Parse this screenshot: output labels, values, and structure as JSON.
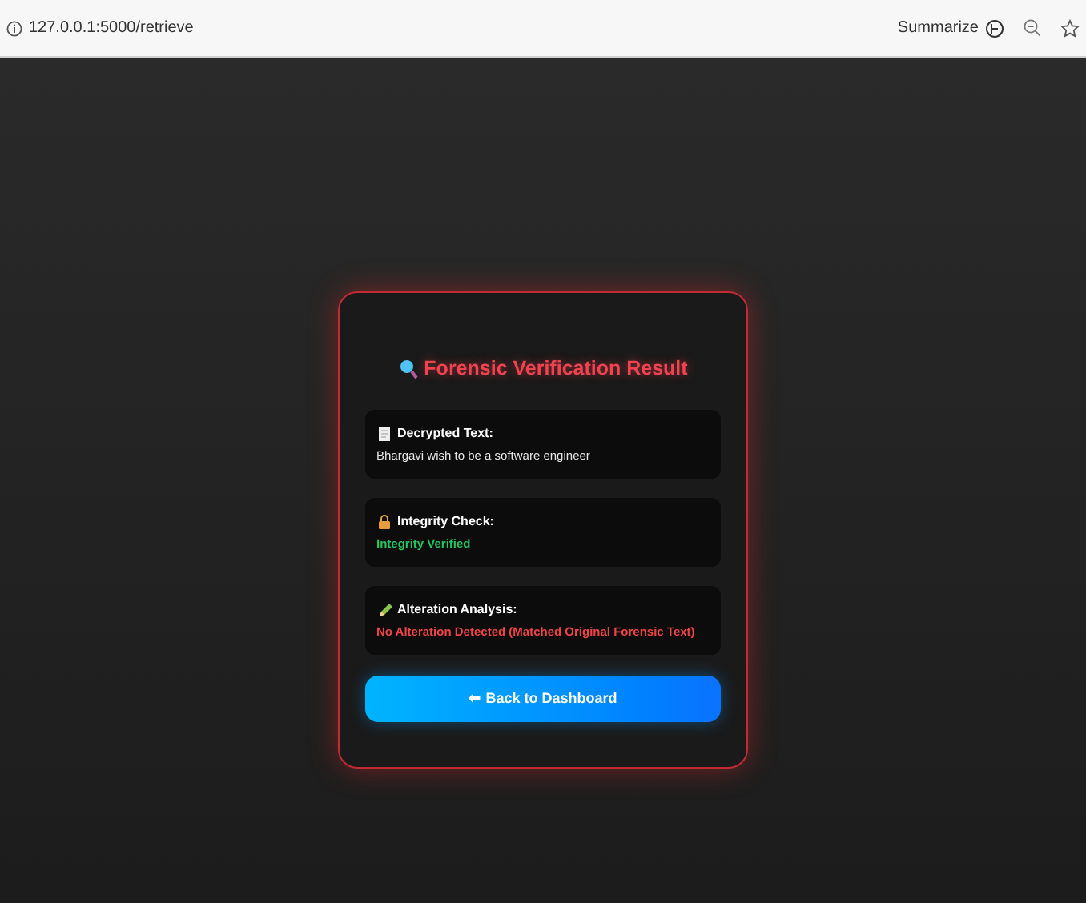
{
  "browser": {
    "url": "127.0.0.1:5000/retrieve",
    "summarize": "Summarize"
  },
  "card": {
    "title": "Forensic Verification Result",
    "sections": [
      {
        "kind": "document",
        "label": "Decrypted Text:",
        "value": "Bhargavi wish to be a software engineer",
        "color": "#e5e5e5"
      },
      {
        "kind": "lock",
        "label": "Integrity Check:",
        "value": "Integrity Verified",
        "color": "#22c55e"
      },
      {
        "kind": "pencil",
        "label": "Alteration Analysis:",
        "value": "No Alteration Detected (Matched Original Forensic Text)",
        "color": "#ef4444"
      }
    ],
    "button": "⬅ Back to Dashboard"
  }
}
